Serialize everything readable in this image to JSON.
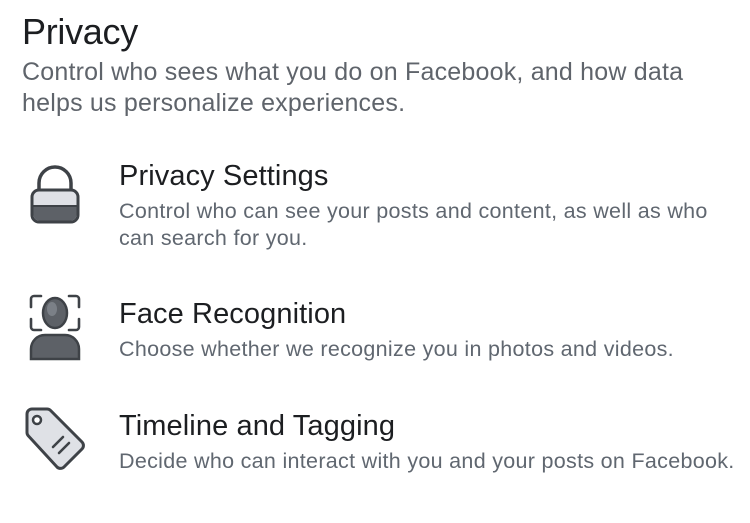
{
  "header": {
    "title": "Privacy",
    "description": "Control who sees what you do on Facebook, and how data helps us personalize experiences."
  },
  "items": [
    {
      "icon": "lock-icon",
      "title": "Privacy Settings",
      "description": "Control who can see your posts and content, as well as who can search for you."
    },
    {
      "icon": "face-recognition-icon",
      "title": "Face Recognition",
      "description": "Choose whether we recognize you in photos and videos."
    },
    {
      "icon": "tag-icon",
      "title": "Timeline and Tagging",
      "description": "Decide who can interact with you and your posts on Facebook."
    }
  ],
  "colors": {
    "icon_stroke": "#3e4247",
    "icon_fill_light": "#dfe1e6",
    "icon_fill_dark": "#5d6167"
  }
}
